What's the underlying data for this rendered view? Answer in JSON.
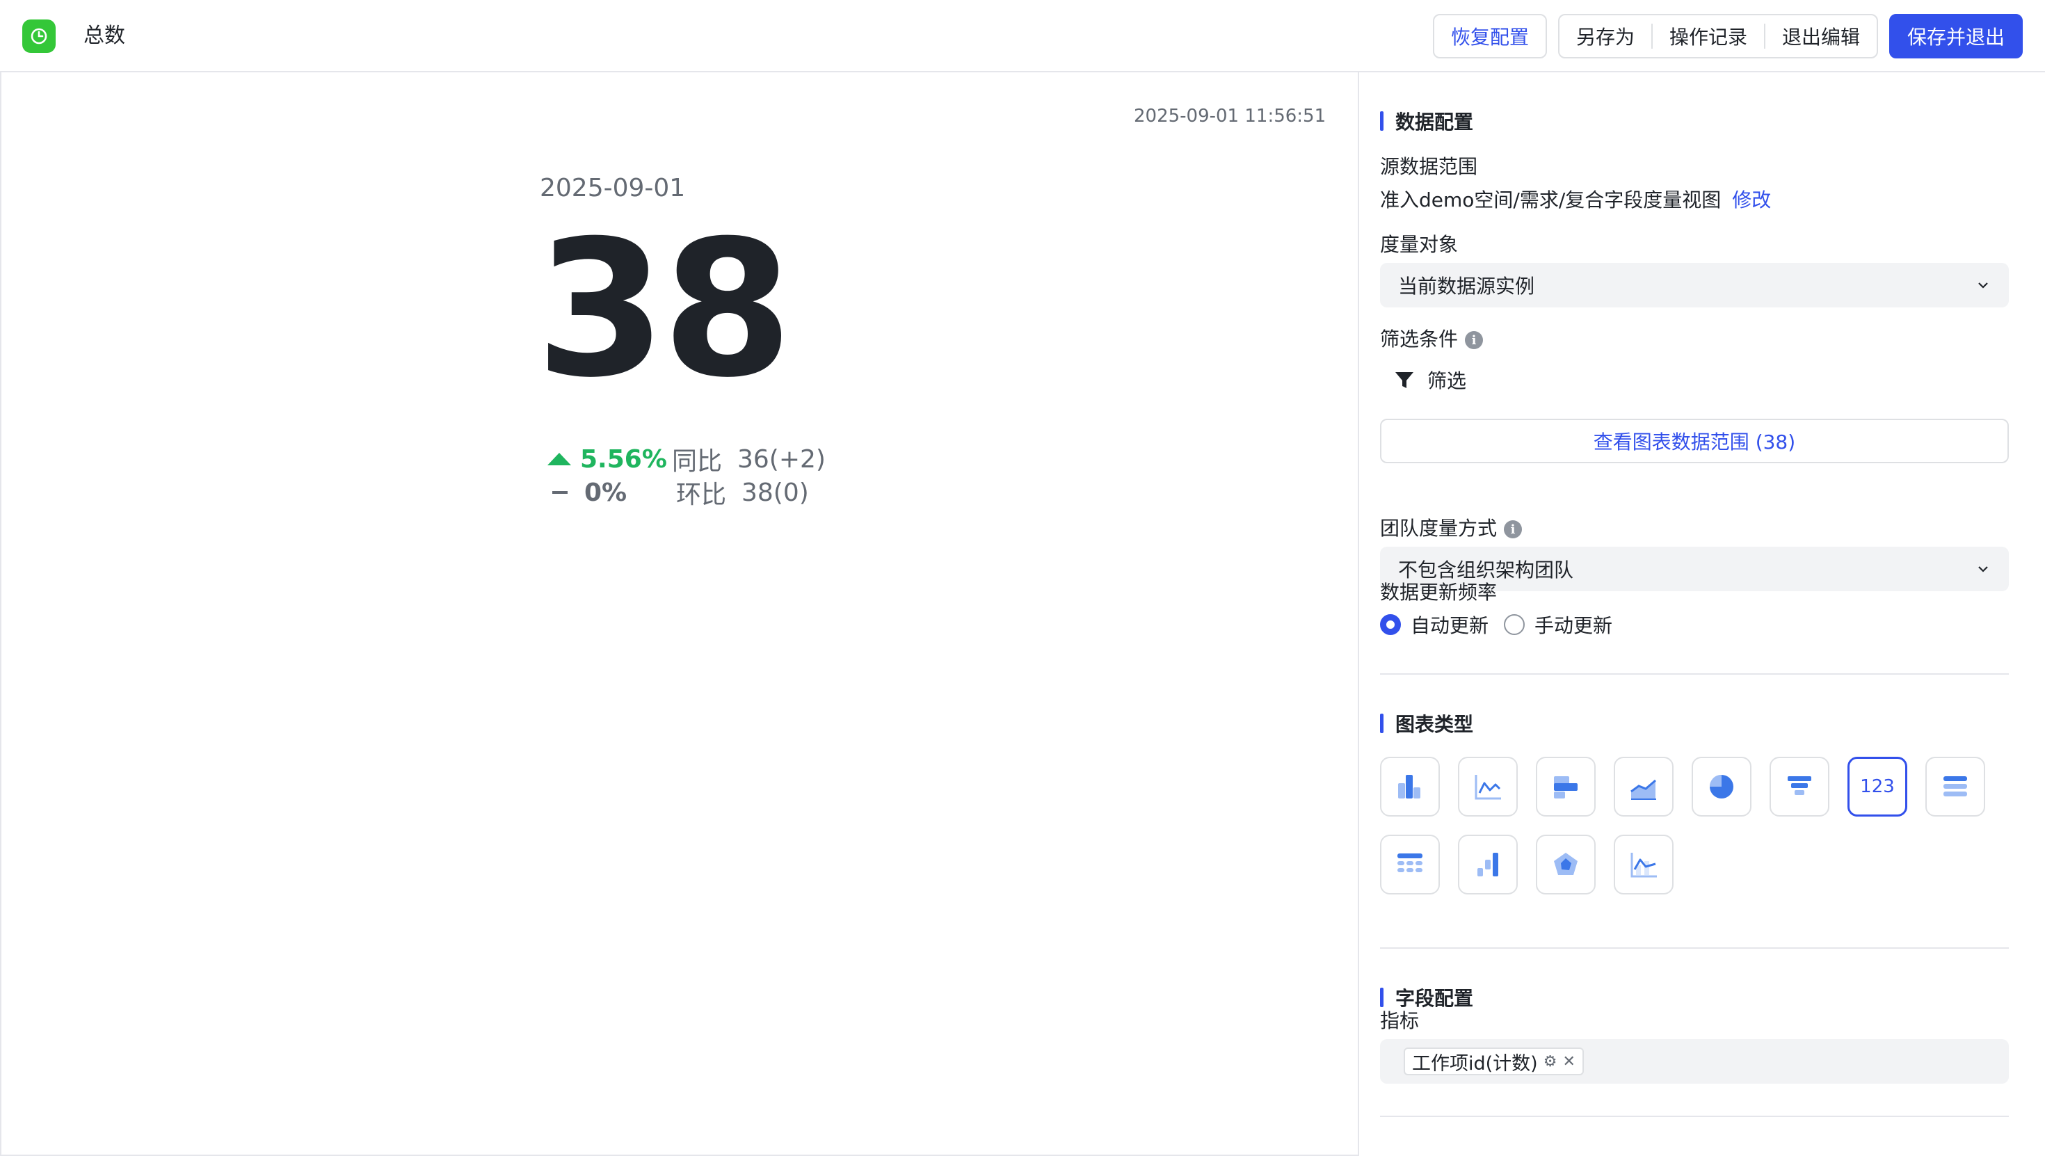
{
  "header": {
    "title": "总数",
    "restore_label": "恢复配置",
    "save_as_label": "另存为",
    "history_label": "操作记录",
    "exit_label": "退出编辑",
    "save_exit_label": "保存并退出"
  },
  "preview": {
    "timestamp": "2025-09-01 11:56:51",
    "date": "2025-09-01",
    "value": "38",
    "yoy": {
      "pct": "5.56%",
      "label": "同比",
      "value": "36(+2)",
      "color": "#1fb55e"
    },
    "mom": {
      "pct": "0%",
      "label": "环比",
      "value": "38(0)",
      "color": "#646a73"
    }
  },
  "config": {
    "data_section": "数据配置",
    "source_label": "源数据范围",
    "source_value": "准入demo空间/需求/复合字段度量视图",
    "source_edit": "修改",
    "measure_label": "度量对象",
    "measure_value": "当前数据源实例",
    "filter_label": "筛选条件",
    "filter_button": "筛选",
    "range_button": "查看图表数据范围 (38)",
    "team_label": "团队度量方式",
    "team_value": "不包含组织架构团队",
    "freq_label": "数据更新频率",
    "freq_auto": "自动更新",
    "freq_manual": "手动更新",
    "chart_section": "图表类型",
    "chart_number_label": "123",
    "field_section": "字段配置",
    "metric_label": "指标",
    "metric_tag": "工作项id(计数)"
  },
  "colors": {
    "accent": "#3250eb",
    "up": "#1fb55e",
    "app_icon": "#34c738"
  }
}
